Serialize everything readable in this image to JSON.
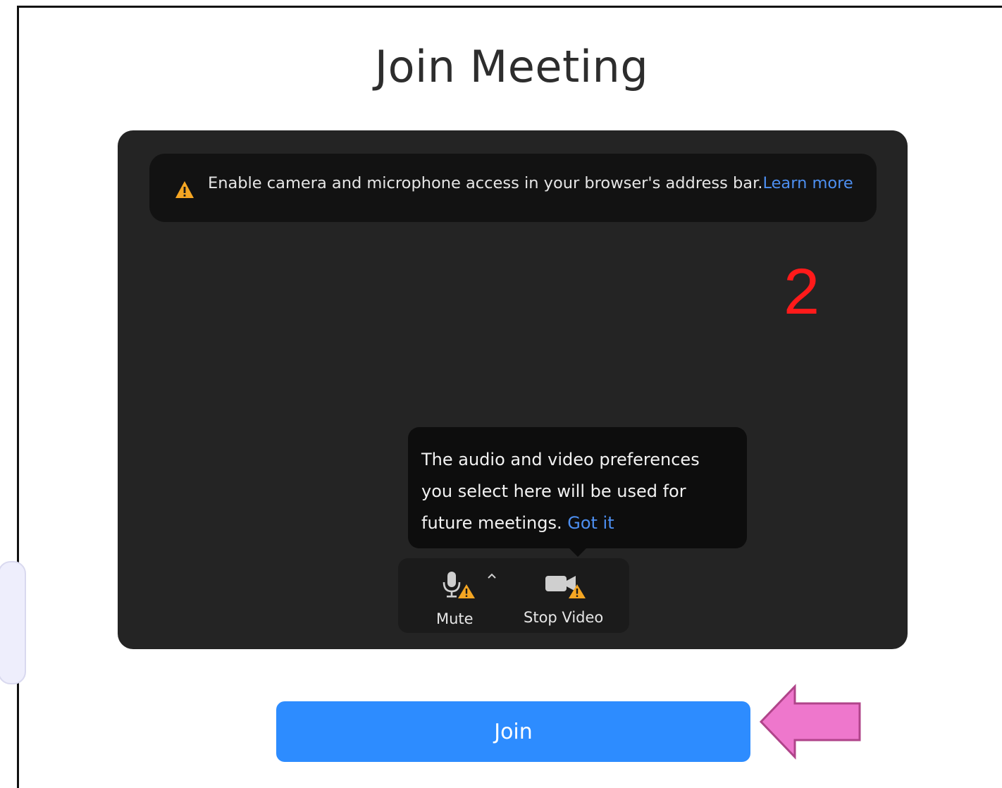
{
  "page": {
    "title": "Join Meeting"
  },
  "banner": {
    "message": "Enable camera and microphone access in your browser's address bar.",
    "link_label": "Learn more",
    "icon": "warning-icon"
  },
  "annotation": {
    "step_number": "2",
    "step_color": "#ff1a1a",
    "arrow_color": "#ee77cc"
  },
  "tooltip": {
    "message": "The audio and video preferences you select here will be used for future meetings.",
    "action_label": "Got it"
  },
  "controls": {
    "mute": {
      "label": "Mute",
      "icon": "microphone-icon"
    },
    "audio_options": {
      "icon": "chevron-up-icon"
    },
    "video": {
      "label": "Stop Video",
      "icon": "video-camera-icon"
    }
  },
  "join": {
    "label": "Join",
    "color": "#2d8cff"
  },
  "colors": {
    "preview_background": "#242424",
    "link": "#4d8ff0",
    "warning": "#f5a623"
  }
}
